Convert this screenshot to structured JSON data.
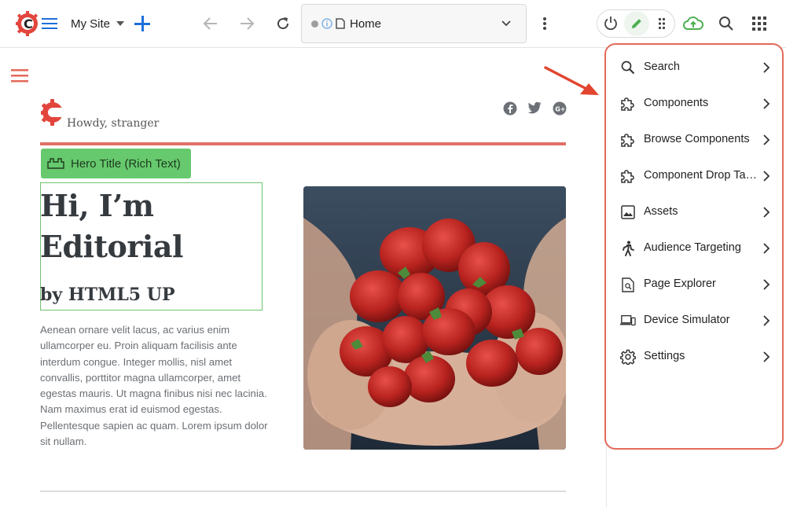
{
  "topbar": {
    "site_name": "My Site",
    "address_label": "Home"
  },
  "page": {
    "greeting": "Howdy, stranger",
    "badge_label": "Hero Title (Rich Text)",
    "hero_title_line1": "Hi, I’m",
    "hero_title_line2": "Editorial",
    "hero_subtitle": "by HTML5 UP",
    "body_text": "Aenean ornare velit lacus, ac varius enim ullamcorper eu. Proin aliquam facilisis ante interdum congue. Integer mollis, nisl amet convallis, porttitor magna ullamcorper, amet egestas mauris. Ut magna finibus nisi nec lacinia. Nam maximus erat id euismod egestas. Pellentesque sapien ac quam. Lorem ipsum dolor sit nullam."
  },
  "menu": {
    "items": [
      {
        "label": "Search",
        "icon": "search-icon"
      },
      {
        "label": "Components",
        "icon": "puzzle-icon"
      },
      {
        "label": "Browse Components",
        "icon": "puzzle-icon"
      },
      {
        "label": "Component Drop Targets",
        "icon": "puzzle-icon"
      },
      {
        "label": "Assets",
        "icon": "image-icon"
      },
      {
        "label": "Audience Targeting",
        "icon": "person-walking-icon"
      },
      {
        "label": "Page Explorer",
        "icon": "page-search-icon"
      },
      {
        "label": "Device Simulator",
        "icon": "devices-icon"
      },
      {
        "label": "Settings",
        "icon": "gear-icon"
      }
    ]
  },
  "colors": {
    "accent_red": "#e36a5a",
    "page_red_line": "#e07068",
    "badge_green": "#66c96d",
    "edit_green": "#4caf50",
    "plus_blue": "#1e6fd9"
  }
}
